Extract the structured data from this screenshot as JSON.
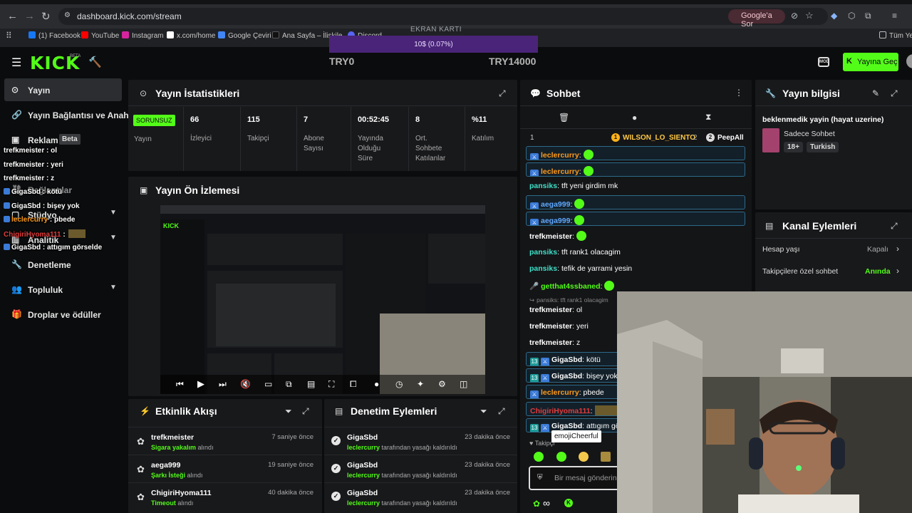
{
  "browser": {
    "url": "dashboard.kick.com/stream",
    "google_chip": "Google'a Sor",
    "bookmarks": [
      "(1) Facebook",
      "YouTube",
      "Instagram",
      "x.com/home",
      "Google Çeviri",
      "Ana Sayfa – İlişkile",
      "Discord"
    ],
    "bookmarks_right": "Tüm Yer"
  },
  "overlay": {
    "gpu_label": "EKRAN KARTI",
    "gpu_value": "10$ (0.07%)",
    "try_min": "TRY0",
    "try_max": "TRY14000"
  },
  "header": {
    "logo": "KICK",
    "logo_beta": "BETA",
    "go_live": "Yayına Geç",
    "moderate_icon_text": "MOD"
  },
  "sidebar": {
    "items": [
      {
        "label": "Yayın"
      },
      {
        "label": "Yayın Bağlantısı ve Anahtar"
      },
      {
        "label": "Reklam"
      },
      {
        "label": "Bağlantılar"
      },
      {
        "label": "Stüdyo"
      },
      {
        "label": "Analitik"
      },
      {
        "label": "Denetleme"
      },
      {
        "label": "Topluluk"
      },
      {
        "label": "Droplar ve ödüller"
      }
    ],
    "beta_tag": "Beta"
  },
  "sidebar_overlay_chat": [
    {
      "user": "trefkmeister",
      "text": " : ol"
    },
    {
      "user": "trefkmeister",
      "text": " : yeri"
    },
    {
      "user": "trefkmeister",
      "text": " : z"
    },
    {
      "user": "GigaSbd",
      "text": " : kötü"
    },
    {
      "user": "GigaSbd",
      "text": " : bişey yok"
    },
    {
      "user": "leclercurry",
      "text": " : pbede"
    },
    {
      "user": "ChigiriHyoma111",
      "text": " : "
    },
    {
      "user": "GigaSbd",
      "text": " : attıgım görselde"
    }
  ],
  "stats": {
    "title": "Yayın İstatistikleri",
    "status_badge": "SORUNSUZ",
    "status_label": "Yayın",
    "cells": [
      {
        "value": "66",
        "label": "İzleyici"
      },
      {
        "value": "115",
        "label": "Takipçi"
      },
      {
        "value": "7",
        "label": "Abone Sayısı"
      },
      {
        "value": "00:52:45",
        "label": "Yayında Olduğu Süre"
      },
      {
        "value": "8",
        "label": "Ort. Sohbete Katılanlar"
      },
      {
        "value": "%11",
        "label": "Katılım"
      }
    ]
  },
  "preview": {
    "title": "Yayın Ön İzlemesi"
  },
  "activity": {
    "title": "Etkinlik Akışı",
    "rows": [
      {
        "name": "trefkmeister",
        "time": "7 saniye önce",
        "highlight": "Sigara yakalım",
        "rest": " alındı"
      },
      {
        "name": "aega999",
        "time": "19 saniye önce",
        "highlight": "Şarkı İsteği",
        "rest": " alındı"
      },
      {
        "name": "ChigiriHyoma111",
        "time": "40 dakika önce",
        "highlight": "Timeout",
        "rest": " alındı"
      }
    ]
  },
  "moderation": {
    "title": "Denetim Eylemleri",
    "rows": [
      {
        "name": "GigaSbd",
        "time": "23 dakika önce",
        "highlight": "leclercurry",
        "rest": " tarafından yasağı kaldırıldı"
      },
      {
        "name": "GigaSbd",
        "time": "23 dakika önce",
        "highlight": "leclercurry",
        "rest": " tarafından yasağı kaldırıldı"
      },
      {
        "name": "GigaSbd",
        "time": "23 dakika önce",
        "highlight": "leclercurry",
        "rest": " tarafından yasağı kaldırıldı"
      }
    ]
  },
  "chat": {
    "title": "Sohbet",
    "pinned_rank": "1",
    "pinned_user": "WILSON_LO_SIENTO",
    "pinned_count": "2",
    "pinned_user2": "PeepAll",
    "messages": [
      {
        "user": "leclercurry",
        "text": ":"
      },
      {
        "user": "leclercurry",
        "text": ":"
      },
      {
        "user": "pansiks",
        "text": ": tft yeni girdim mk"
      },
      {
        "user": "aega999",
        "text": ":"
      },
      {
        "user": "aega999",
        "text": ":"
      },
      {
        "user": "trefkmeister",
        "text": ":"
      },
      {
        "user": "pansiks",
        "text": ": tft rank1 olacagim"
      },
      {
        "user": "pansiks",
        "text": ": tefik de yarrami yesin"
      },
      {
        "user": "getthat4ssbaned",
        "text": ":"
      },
      {
        "user": "pansiks",
        "text": ": tft rank1 olacagim"
      },
      {
        "user": "trefkmeister",
        "text": ": ol"
      },
      {
        "user": "trefkmeister",
        "text": ": yeri"
      },
      {
        "user": "trefkmeister",
        "text": ": z"
      },
      {
        "user": "GigaSbd",
        "text": ": kötü"
      },
      {
        "user": "GigaSbd",
        "text": ": bişey yok"
      },
      {
        "user": "leclercurry",
        "text": ": pbede"
      },
      {
        "user": "ChigiriHyoma111",
        "text": ":"
      },
      {
        "user": "GigaSbd",
        "text": ": attıgım gö"
      }
    ],
    "tooltip": "emojiCheerful",
    "followers_only": "Takipçi",
    "input_placeholder": "Bir mesaj gönderin",
    "infinity": "∞"
  },
  "stream_info": {
    "title": "Yayın bilgisi",
    "stream_title": "beklenmedik yayin (hayat uzerine)",
    "category": "Sadece Sohbet",
    "tags": [
      "18+",
      "Turkish"
    ]
  },
  "channel_actions": {
    "title": "Kanal Eylemleri",
    "rows": [
      {
        "label": "Hesap yaşı",
        "value": "Kapalı"
      },
      {
        "label": "Takipçilere özel sohbet",
        "value": "Anında"
      }
    ]
  },
  "colors": {
    "accent": "#53fc18",
    "panel": "#18191b",
    "background": "#0b0c0d"
  }
}
